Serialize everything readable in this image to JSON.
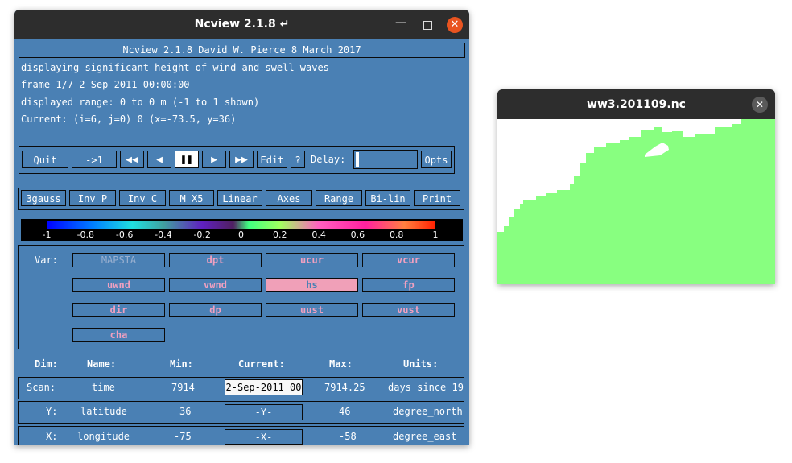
{
  "main_window": {
    "title": "Ncview 2.1.8 ↵",
    "header": "Ncview 2.1.8 David W. Pierce  8 March 2017",
    "info": [
      "displaying significant height of wind and swell waves",
      "frame 1/7 2-Sep-2011 00:00:00",
      "displayed range: 0 to 0 m (-1 to 1 shown)",
      "Current: (i=6, j=0) 0 (x=-73.5, y=36)"
    ],
    "controls": {
      "quit": "Quit",
      "goto_first": "->1",
      "edit": "Edit",
      "help": "?",
      "delay_label": "Delay:",
      "opts": "Opts",
      "icons": {
        "rewind": "fast-rewind-icon",
        "back": "step-back-icon",
        "pause": "pause-icon",
        "forward": "step-forward-icon",
        "fast_forward": "fast-forward-icon"
      }
    },
    "options": [
      "3gauss",
      "Inv P",
      "Inv C",
      "M X5",
      "Linear",
      "Axes",
      "Range",
      "Bi-lin",
      "Print"
    ],
    "colorbar": {
      "ticks": [
        "-1",
        "-0.8",
        "-0.6",
        "-0.4",
        "-0.2",
        "0",
        "0.2",
        "0.4",
        "0.6",
        "0.8",
        "1"
      ],
      "colors": [
        "#0000ff",
        "#20e0e0",
        "#6020c0",
        "#40ff80",
        "#ff60c0",
        "#ff2000"
      ]
    },
    "variables": {
      "label": "Var:",
      "items": [
        "MAPSTA",
        "dpt",
        "ucur",
        "vcur",
        "uwnd",
        "vwnd",
        "hs",
        "fp",
        "dir",
        "dp",
        "uust",
        "vust",
        "cha"
      ],
      "selected": "hs",
      "disabled": "MAPSTA"
    },
    "dimensions": {
      "headers": [
        "Dim:",
        "Name:",
        "Min:",
        "Current:",
        "Max:",
        "Units:"
      ],
      "rows": [
        {
          "dim": "Scan:",
          "name": "time",
          "min": "7914",
          "current": "2-Sep-2011 00",
          "max": "7914.25",
          "units": "days since 19"
        },
        {
          "dim": "Y:",
          "name": "latitude",
          "min": "36",
          "current": "-Y-",
          "max": "46",
          "units": "degree_north"
        },
        {
          "dim": "X:",
          "name": "longitude",
          "min": "-75",
          "current": "-X-",
          "max": "-58",
          "units": "degree_east"
        }
      ]
    }
  },
  "plot_window": {
    "title": "ww3.201109.nc",
    "colors": {
      "ocean": "#88ff80",
      "land": "#ffffff"
    }
  },
  "colors": {
    "panel": "#4a80b4",
    "titlebar": "#2d2d2d",
    "close_accent": "#e95420",
    "variable_text": "#f0a0c0"
  }
}
